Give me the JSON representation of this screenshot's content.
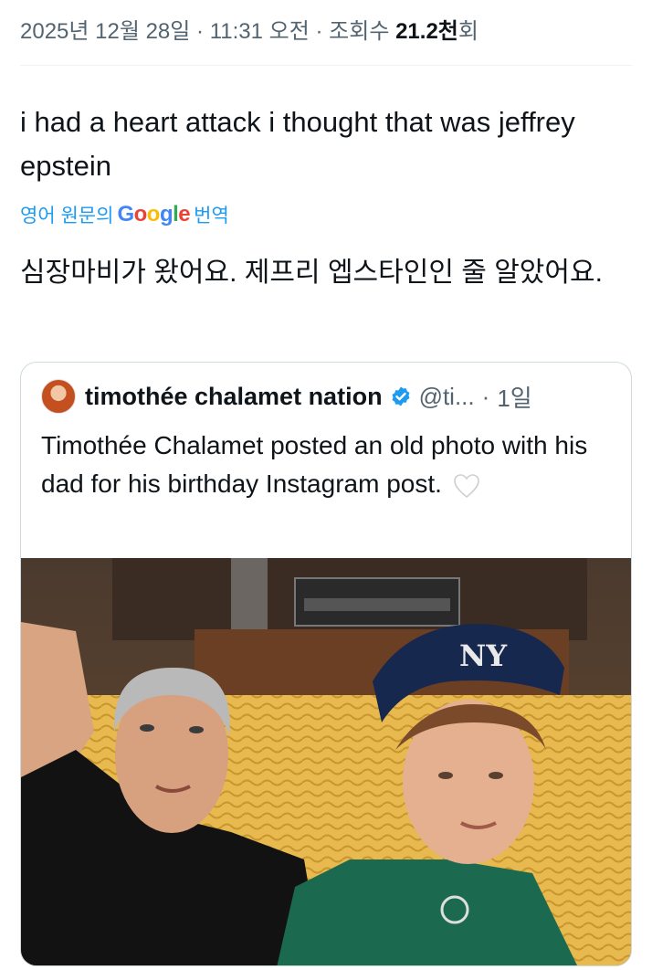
{
  "meta": {
    "date": "2025년 12월 28일",
    "time": "11:31 오전",
    "separator": "·",
    "views_label": "조회수",
    "views_count": "21.2천",
    "views_suffix": "회"
  },
  "tweet": {
    "text": "i had a heart attack i thought that was jeffrey epstein",
    "translate_prefix": "영어 원문의",
    "translate_brand": "Google",
    "translate_suffix": "번역",
    "translated_text": "심장마비가 왔어요. 제프리 엡스타인인 줄 알았어요."
  },
  "quote": {
    "display_name": "timothée chalamet nation",
    "handle": "@ti...",
    "time_sep": "·",
    "age": "1일",
    "text": "Timothée Chalamet posted an old photo with his dad for his birthday Instagram post.",
    "emoji_icon": "white-heart-icon",
    "cap_logo": "NY"
  },
  "colors": {
    "link_blue": "#1d9bf0",
    "muted": "#536471",
    "border": "#cfd9de",
    "verified": "#1d9bf0"
  }
}
